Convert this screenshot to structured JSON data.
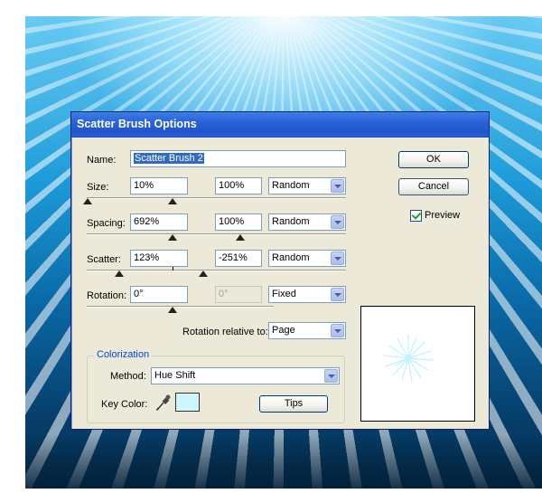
{
  "dialog": {
    "title": "Scatter Brush Options",
    "name_label": "Name:",
    "name_value": "Scatter Brush 2",
    "ok_label": "OK",
    "cancel_label": "Cancel",
    "preview_label": "Preview",
    "preview_checked": true
  },
  "rows": {
    "size": {
      "label": "Size:",
      "min": "10%",
      "max": "100%",
      "mode": "Random"
    },
    "spacing": {
      "label": "Spacing:",
      "min": "692%",
      "max": "100%",
      "mode": "Random"
    },
    "scatter": {
      "label": "Scatter:",
      "min": "123%",
      "max": "-251%",
      "mode": "Random"
    },
    "rotation": {
      "label": "Rotation:",
      "min": "0°",
      "max": "0°",
      "mode": "Fixed"
    }
  },
  "rotation_relative": {
    "label": "Rotation relative to:",
    "value": "Page"
  },
  "colorization": {
    "legend": "Colorization",
    "method_label": "Method:",
    "method_value": "Hue Shift",
    "key_color_label": "Key Color:",
    "key_color": "#ccf7ff",
    "tips_label": "Tips"
  },
  "colors": {
    "title_bar": "#2a63d8",
    "dialog_bg": "#ece9d8",
    "accent_blue": "#0046d5",
    "brush_color": "#bff2ff"
  },
  "icons": {
    "eyedropper": "eyedropper-icon",
    "dropdown": "chevron-down-icon",
    "checkbox": "checkmark-icon"
  }
}
